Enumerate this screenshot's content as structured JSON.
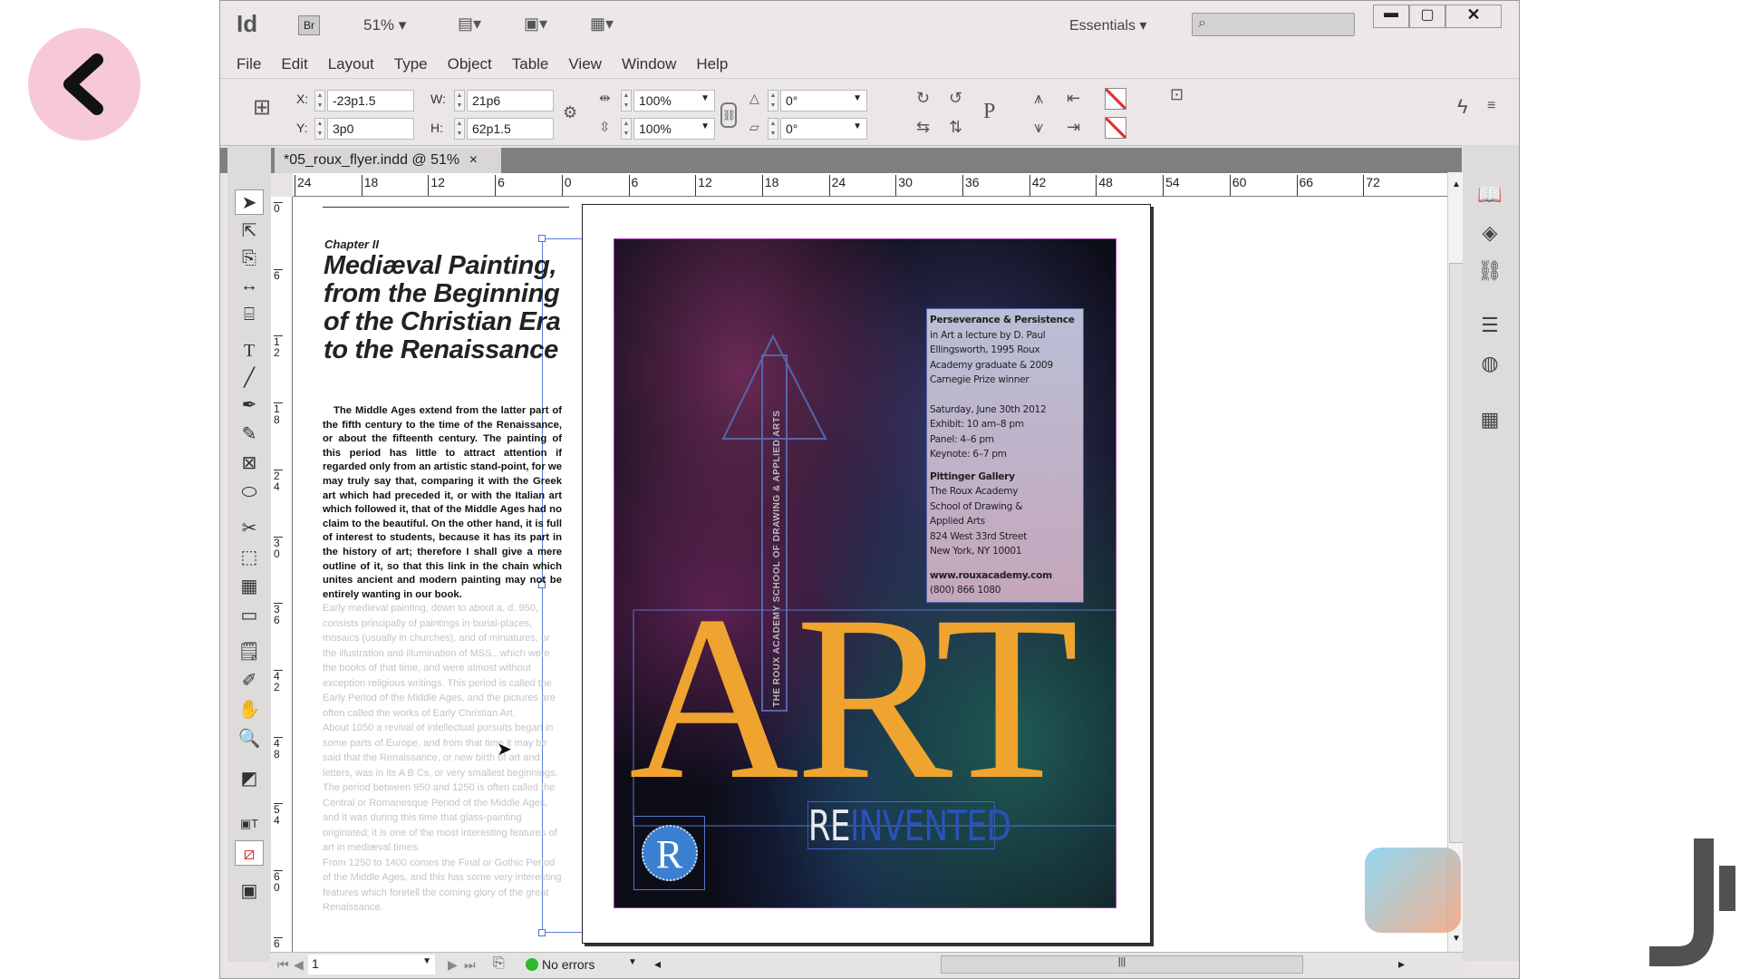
{
  "app": {
    "logo": "Id",
    "bridge": "Br",
    "zoom": "51%",
    "workspace": "Essentials",
    "search_placeholder": ""
  },
  "menu": [
    "File",
    "Edit",
    "Layout",
    "Type",
    "Object",
    "Table",
    "View",
    "Window",
    "Help"
  ],
  "control": {
    "x_label": "X:",
    "x": "-23p1.5",
    "y_label": "Y:",
    "y": "3p0",
    "w_label": "W:",
    "w": "21p6",
    "h_label": "H:",
    "h": "62p1.5",
    "scale_x": "100%",
    "scale_y": "100%",
    "rotate": "0°",
    "shear": "0°"
  },
  "document_tab": {
    "title": "*05_roux_flyer.indd @ 51%",
    "close": "×"
  },
  "ruler": {
    "h_ticks": [
      "24",
      "18",
      "12",
      "6",
      "0",
      "6",
      "12",
      "18",
      "24",
      "30",
      "36",
      "42",
      "48",
      "54",
      "60",
      "66",
      "72"
    ],
    "v_ticks": [
      "0",
      "6",
      "1 2",
      "1 8",
      "2 4",
      "3 0",
      "3 6",
      "4 2",
      "4 8",
      "5 4",
      "6 0",
      "6"
    ]
  },
  "left_page": {
    "chapter": "Chapter II",
    "heading": "Mediæval Painting, from the Beginning of the Christian Era to the Renaissance",
    "body_main": "The Middle Ages extend from the latter part of the fifth century to the time of the Renaissance, or about the fifteenth century. The painting of this period has little to attract attention if regarded only from an artistic stand-point, for we may truly say that, comparing it with the Greek art which had preceded it, or with the Italian art which followed it, that of the Middle Ages had no claim to the beautiful. On the other hand, it is full of interest to students, because it has its part in the history of art; therefore I shall give a mere outline of it, so that this link in the chain which unites ancient and modern painting may not be entirely wanting in our book.",
    "body_faded": [
      "Early medieval painting, down to about a. d. 950, consists principally of paintings in burial-places, mosaics (usually in churches), and of miniatures, or the illustration and illumination of MSS., which were the books of that time, and were almost without exception religious writings. This period is called the Early Period of the Middle Ages, and the pictures are often called the works of Early Christian Art.",
      "About 1050 a revival of intellectual pursuits began in some parts of Europe, and from that time it may be said that the Renaissance, or new birth of art and letters, was in its A B Cs, or very smallest beginnings. The period between 950 and 1250 is often called the Central or Romanesque Period of the Middle Ages, and it was during this time that glass-painting originated; it is one of the most interesting features of art in mediæval times.",
      "From 1250 to 1400 comes the Final or Gothic Period of the Middle Ages, and this has some very interesting features which foretell the coming glory of the great Renaissance."
    ]
  },
  "poster": {
    "info_title": "Perseverance & Persistence",
    "info_lines": [
      "in Art a lecture by D. Paul Ellingsworth, 1995 Roux Academy graduate & 2009 Carnegie Prize winner"
    ],
    "date": "Saturday, June 30th 2012",
    "exhibit": "Exhibit: 10 am–8 pm",
    "panel": "Panel: 4–6 pm",
    "keynote": "Keynote: 6–7 pm",
    "gallery": "Pittinger Gallery",
    "address": [
      "The Roux Academy",
      "School of Drawing &",
      "Applied Arts",
      "824 West 33rd Street",
      "New York, NY 10001"
    ],
    "web": "www.rouxacademy.com",
    "phone": "(800) 866 1080",
    "headline": "ART",
    "sub_re": "RE",
    "sub_invented": "INVENTED",
    "vertical": "THE ROUX ACADEMY SCHOOL OF DRAWING & APPLIED ARTS",
    "logo_letter": "R",
    "art_color": "#f0a430"
  },
  "status": {
    "page": "1",
    "preflight": "No errors",
    "preflight_color": "#2db82d"
  }
}
